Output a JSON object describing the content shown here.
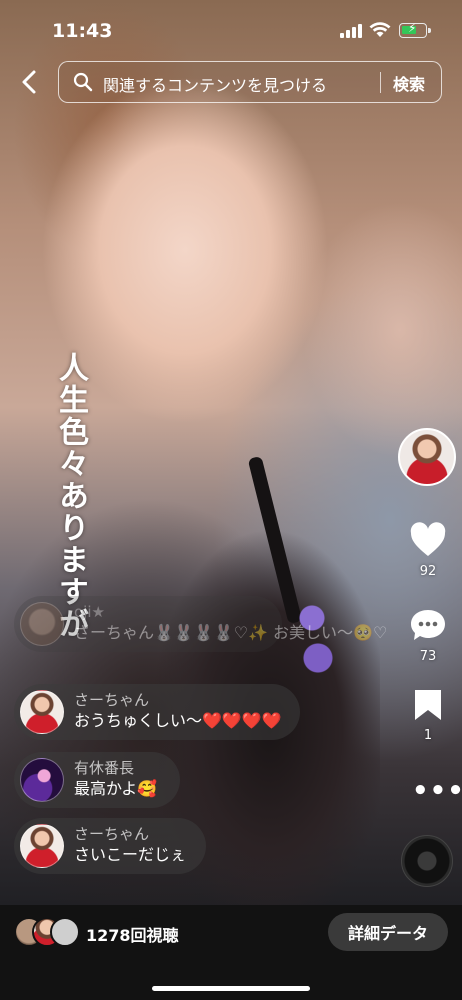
{
  "status_bar": {
    "time": "11:43"
  },
  "search": {
    "placeholder": "関連するコンテンツを見つける",
    "submit_label": "検索"
  },
  "caption": "人生色々ありますが",
  "actions": {
    "likes": "92",
    "comments": "73",
    "saves": "1"
  },
  "comments": [
    {
      "name": "oji★",
      "text": "さーちゃん🐰🐰🐰🐰♡✨ お美しい〜🥺♡"
    },
    {
      "name": "さーちゃん",
      "text": "おうちゅくしい〜❤️❤️❤️❤️"
    },
    {
      "name": "有休番長",
      "text": "最高かよ🥰"
    },
    {
      "name": "さーちゃん",
      "text": "さいこーだじぇ"
    }
  ],
  "bottom_bar": {
    "views": "1278回視聴",
    "details_label": "詳細データ"
  },
  "colors": {
    "battery": "#34c759",
    "like_heart": "#ffffff",
    "details_button_bg": "#3a3a3a"
  }
}
